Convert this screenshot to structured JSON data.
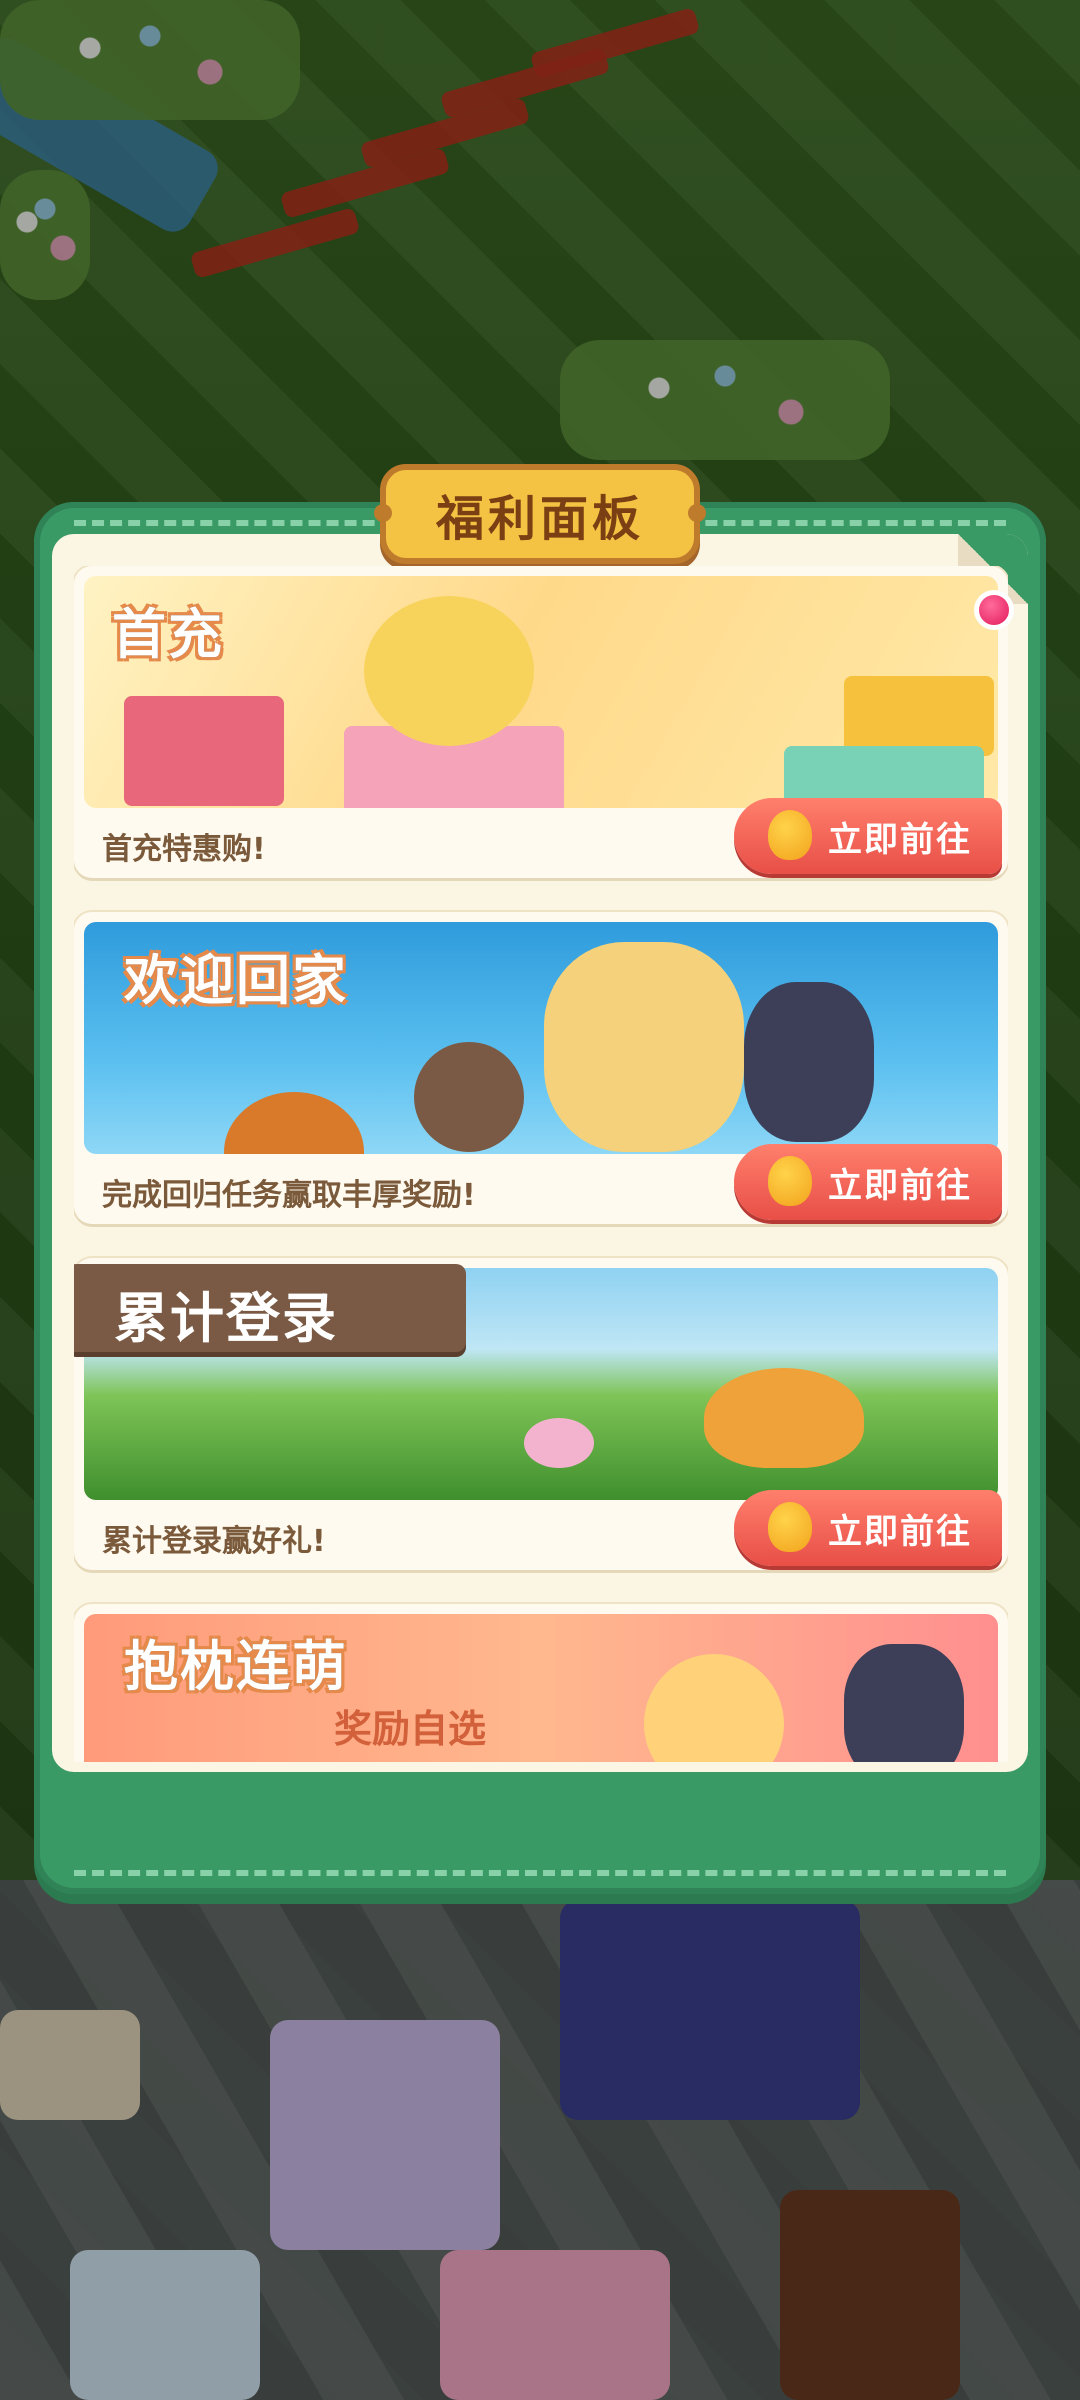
{
  "modal": {
    "title": "福利面板"
  },
  "cards": [
    {
      "banner_title": "首充",
      "description": "首充特惠购!",
      "button_label": "立即前往"
    },
    {
      "banner_title": "欢迎回家",
      "description": "完成回归任务赢取丰厚奖励!",
      "button_label": "立即前往"
    },
    {
      "banner_title": "累计登录",
      "description": "累计登录赢好礼!",
      "button_label": "立即前往"
    },
    {
      "banner_title": "抱枕连萌",
      "subtitle": "奖励自选"
    }
  ],
  "colors": {
    "modal_green": "#3a9a66",
    "paper": "#fbf5e4",
    "title_plate": "#f5c344",
    "button_red": "#e84f47",
    "badge_pink": "#e31b5c"
  },
  "icons": {
    "button": "chick-icon",
    "badge": "notification-dot-icon"
  }
}
